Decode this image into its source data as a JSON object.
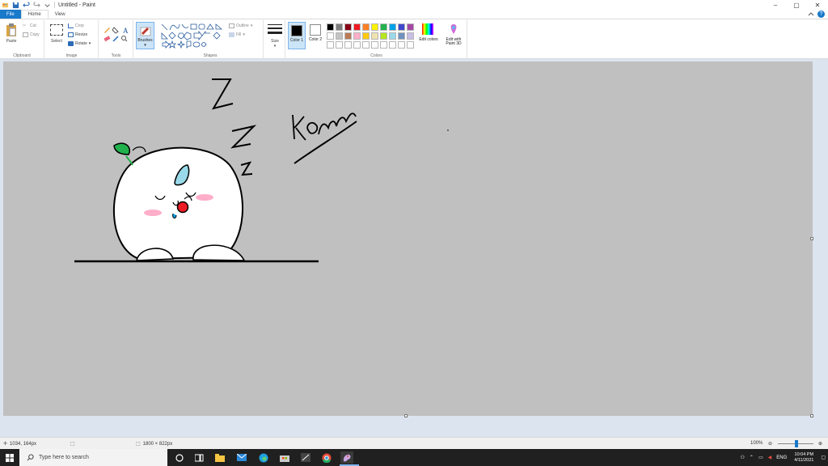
{
  "window": {
    "title": "Untitled - Paint",
    "controls": [
      "–",
      "▢",
      "✕"
    ]
  },
  "tabs": [
    {
      "label": "File"
    },
    {
      "label": "Home"
    },
    {
      "label": "View"
    }
  ],
  "ribbon": {
    "clipboard": {
      "paste": "Paste",
      "cut": "Cut",
      "copy": "Copy",
      "label": "Clipboard"
    },
    "image": {
      "select": "Select",
      "crop": "Crop",
      "resize": "Resize",
      "rotate": "Rotate",
      "label": "Image"
    },
    "tools": {
      "label": "Tools"
    },
    "brushes": {
      "label": "Brushes"
    },
    "shapes": {
      "outline": "Outline",
      "fill": "Fill",
      "label": "Shapes"
    },
    "size": {
      "label": "Size"
    },
    "colors": {
      "color1": "Color 1",
      "color2": "Color 2",
      "edit_colors": "Edit colors",
      "paint3d": "Edit with Paint 3D",
      "label": "Colors",
      "palette_row1": [
        "#000000",
        "#7f7f7f",
        "#880015",
        "#ed1c24",
        "#ff7f27",
        "#fff200",
        "#22b14c",
        "#00a2e8",
        "#3f48cc",
        "#a349a4"
      ],
      "palette_row2": [
        "#ffffff",
        "#c3c3c3",
        "#b97a57",
        "#ffaec9",
        "#ffc90e",
        "#efe4b0",
        "#b5e61d",
        "#99d9ea",
        "#7092be",
        "#c8bfe7"
      ],
      "palette_row3": [
        "#ffffff",
        "#ffffff",
        "#ffffff",
        "#ffffff",
        "#ffffff",
        "#ffffff",
        "#ffffff",
        "#ffffff",
        "#ffffff",
        "#ffffff"
      ]
    }
  },
  "canvas": {
    "background": "#c0c0c0",
    "drawing_text": "kom",
    "zzz": [
      "Z",
      "Z",
      "Z"
    ]
  },
  "status": {
    "cursor_pos": "1034, 164px",
    "canvas_size": "1800 × 822px",
    "zoom": "100%"
  },
  "taskbar": {
    "search_placeholder": "Type here to search",
    "lang": "ENG",
    "time": "10:04 PM",
    "date": "4/11/2021"
  }
}
